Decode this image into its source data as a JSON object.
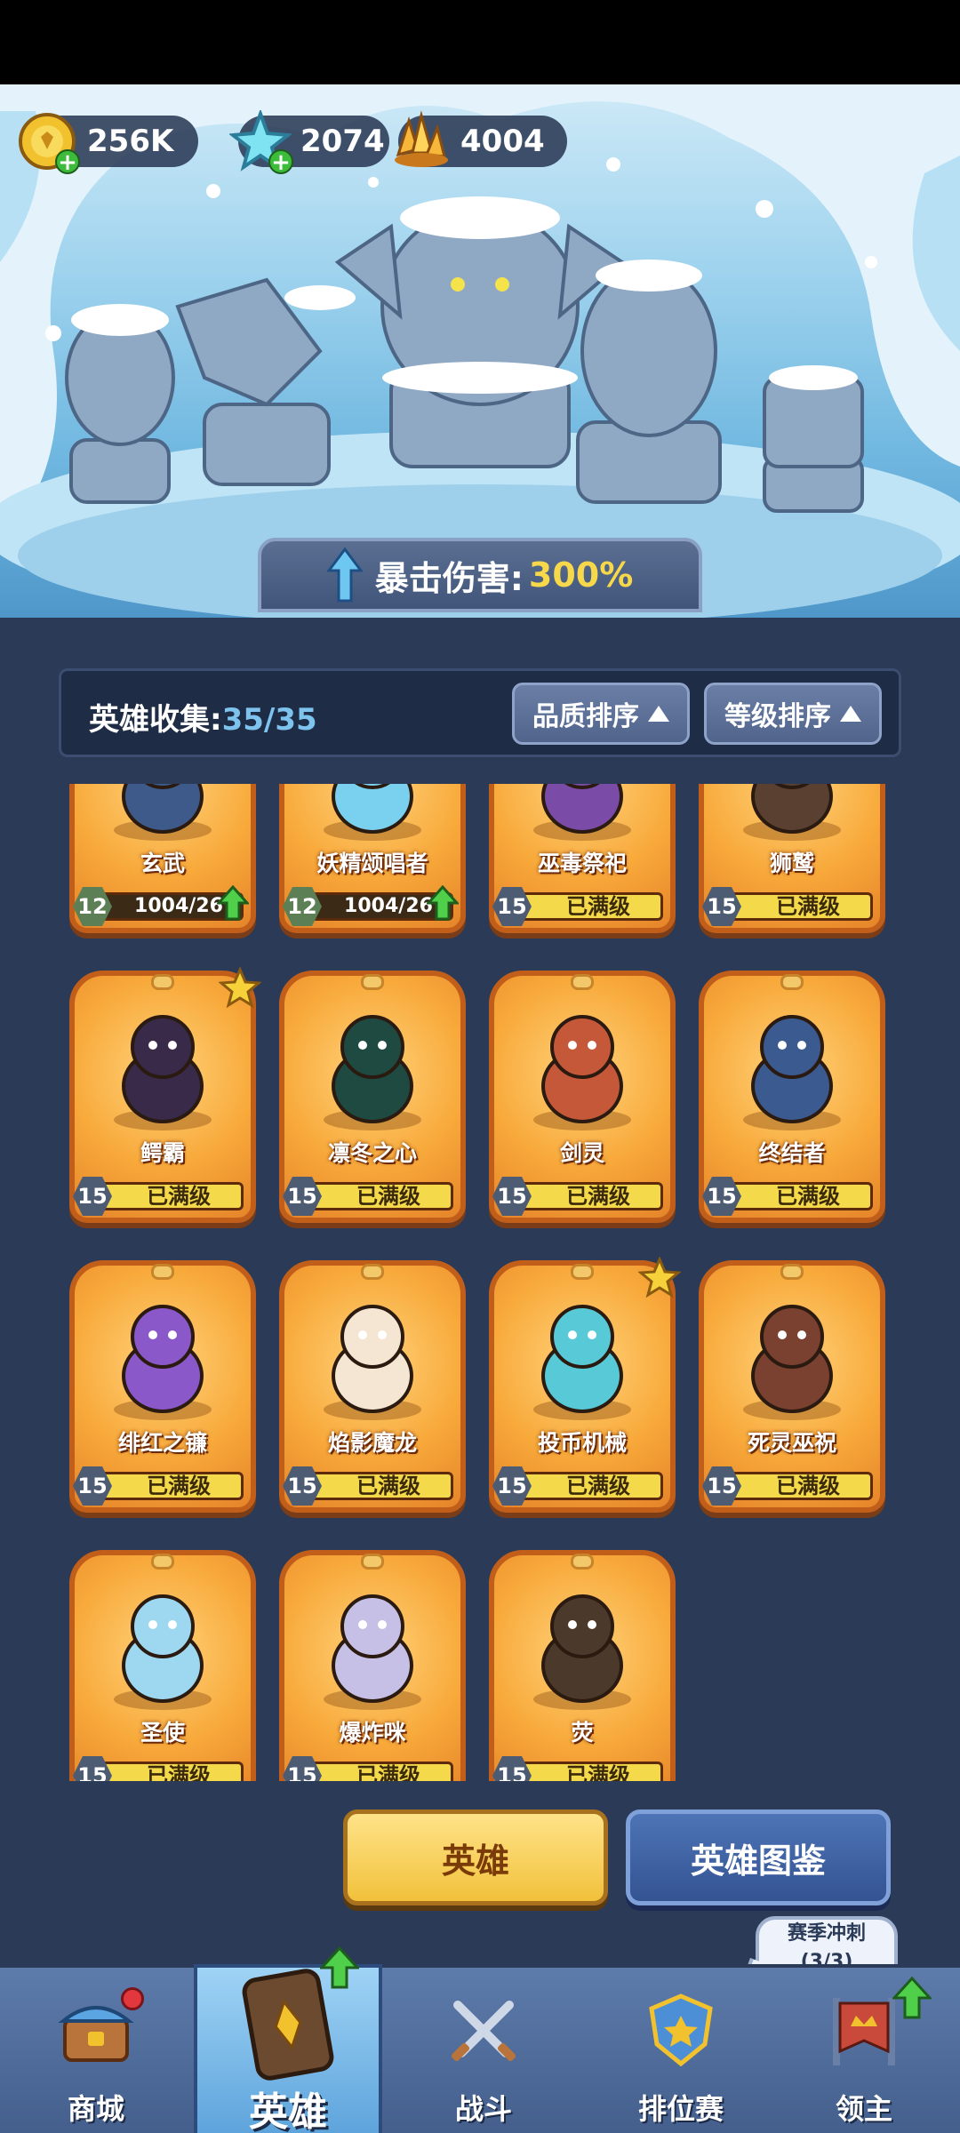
{
  "currencies": {
    "gold": "256K",
    "gem": "2074",
    "crystal": "4004"
  },
  "crit_banner": {
    "label": "暴击伤害:",
    "value": "300%"
  },
  "collection": {
    "label": "英雄收集:",
    "count": "35/35"
  },
  "sort": {
    "quality": "品质排序",
    "level": "等级排序"
  },
  "heroes": [
    {
      "name": "玄武",
      "level": "12",
      "bar": "1004/26",
      "upgradable": true,
      "star": false
    },
    {
      "name": "妖精颂唱者",
      "level": "12",
      "bar": "1004/26",
      "upgradable": true,
      "star": false
    },
    {
      "name": "巫毒祭祀",
      "level": "15",
      "bar": "已满级",
      "upgradable": false,
      "star": false
    },
    {
      "name": "狮鹫",
      "level": "15",
      "bar": "已满级",
      "upgradable": false,
      "star": false
    },
    {
      "name": "鳄霸",
      "level": "15",
      "bar": "已满级",
      "upgradable": false,
      "star": true
    },
    {
      "name": "凛冬之心",
      "level": "15",
      "bar": "已满级",
      "upgradable": false,
      "star": false
    },
    {
      "name": "剑灵",
      "level": "15",
      "bar": "已满级",
      "upgradable": false,
      "star": false
    },
    {
      "name": "终结者",
      "level": "15",
      "bar": "已满级",
      "upgradable": false,
      "star": false
    },
    {
      "name": "绯红之镰",
      "level": "15",
      "bar": "已满级",
      "upgradable": false,
      "star": false
    },
    {
      "name": "焰影魔龙",
      "level": "15",
      "bar": "已满级",
      "upgradable": false,
      "star": false
    },
    {
      "name": "投币机械",
      "level": "15",
      "bar": "已满级",
      "upgradable": false,
      "star": true
    },
    {
      "name": "死灵巫祝",
      "level": "15",
      "bar": "已满级",
      "upgradable": false,
      "star": false
    },
    {
      "name": "圣使",
      "level": "15",
      "bar": "已满级",
      "upgradable": false,
      "star": false
    },
    {
      "name": "爆炸咪",
      "level": "15",
      "bar": "已满级",
      "upgradable": false,
      "star": false
    },
    {
      "name": "荧",
      "level": "15",
      "bar": "已满级",
      "upgradable": false,
      "star": false
    }
  ],
  "buttons": {
    "heroes": "英雄",
    "guide": "英雄图鉴"
  },
  "season": {
    "title": "赛季冲刺",
    "progress": "(3/3)"
  },
  "nav": {
    "shop": "商城",
    "heroes": "英雄",
    "battle": "战斗",
    "ranked": "排位赛",
    "lord": "领主"
  },
  "colors": {
    "panel": "#2a3a57",
    "card_orange": "#f8a93a",
    "accent_yellow": "#f7d84a",
    "count_blue": "#7ec3ee"
  }
}
